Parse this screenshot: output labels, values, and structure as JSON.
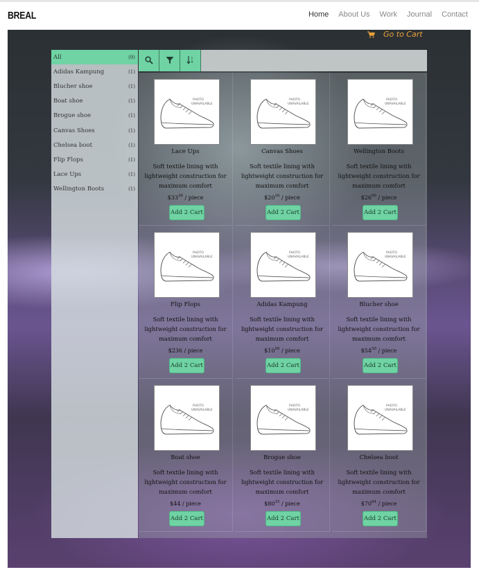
{
  "site": {
    "logo": "BREAL",
    "nav": [
      "Home",
      "About Us",
      "Work",
      "Journal",
      "Contact"
    ]
  },
  "cart_link": {
    "label": "Go to Cart",
    "icon": "cart-icon"
  },
  "categories": [
    {
      "label": "All",
      "count": "(9)"
    },
    {
      "label": "Adidas Kampung",
      "count": "(1)"
    },
    {
      "label": "Blucher shoe",
      "count": "(1)"
    },
    {
      "label": "Boat shoe",
      "count": "(1)"
    },
    {
      "label": "Brogue shoe",
      "count": "(1)"
    },
    {
      "label": "Canvas Shoes",
      "count": "(1)"
    },
    {
      "label": "Chelsea boot",
      "count": "(1)"
    },
    {
      "label": "Flip Flops",
      "count": "(1)"
    },
    {
      "label": "Lace Ups",
      "count": "(1)"
    },
    {
      "label": "Wellington Boots",
      "count": "(1)"
    }
  ],
  "toolbar": {
    "icons": [
      "search-icon",
      "filter-icon",
      "sort-icon"
    ]
  },
  "photo_placeholder": [
    "PHOTO",
    "UNAVAILABLE"
  ],
  "products": [
    {
      "name": "Lace Ups",
      "desc": "Soft textile lining with lightweight construction for maximum comfort",
      "price_main": "$33",
      "price_sup": "36",
      "unit": " / piece",
      "button": "Add 2 Cart"
    },
    {
      "name": "Canvas Shoes",
      "desc": "Soft textile lining with lightweight construction for maximum comfort",
      "price_main": "$20",
      "price_sup": "16",
      "unit": " / piece",
      "button": "Add 2 Cart"
    },
    {
      "name": "Wellington Boots",
      "desc": "Soft textile lining with lightweight construction for maximum comfort",
      "price_main": "$26",
      "price_sup": "50",
      "unit": " / piece",
      "button": "Add 2 Cart"
    },
    {
      "name": "Flip Flops",
      "desc": "Soft textile lining with lightweight construction for maximum comfort",
      "price_main": "$236",
      "price_sup": "",
      "unit": " / piece",
      "button": "Add 2 Cart"
    },
    {
      "name": "Adidas Kampung",
      "desc": "Soft textile lining with lightweight construction for maximum comfort",
      "price_main": "$10",
      "price_sup": "50",
      "unit": " / piece",
      "button": "Add 2 Cart"
    },
    {
      "name": "Blucher shoe",
      "desc": "Soft textile lining with lightweight construction for maximum comfort",
      "price_main": "$54",
      "price_sup": "30",
      "unit": " / piece",
      "button": "Add 2 Cart"
    },
    {
      "name": "Boat shoe",
      "desc": "Soft textile lining with lightweight construction for maximum comfort",
      "price_main": "$44",
      "price_sup": "",
      "unit": " / piece",
      "button": "Add 2 Cart"
    },
    {
      "name": "Brogue shoe",
      "desc": "Soft textile lining with lightweight construction for maximum comfort",
      "price_main": "$80",
      "price_sup": "35",
      "unit": " / piece",
      "button": "Add 2 Cart"
    },
    {
      "name": "Chelsea boot",
      "desc": "Soft textile lining with lightweight construction for maximum comfort",
      "price_main": "$70",
      "price_sup": "64",
      "unit": " / piece",
      "button": "Add 2 Cart"
    }
  ],
  "colors": {
    "accent": "#6fd3a3",
    "cart_link": "#e8a13a"
  }
}
